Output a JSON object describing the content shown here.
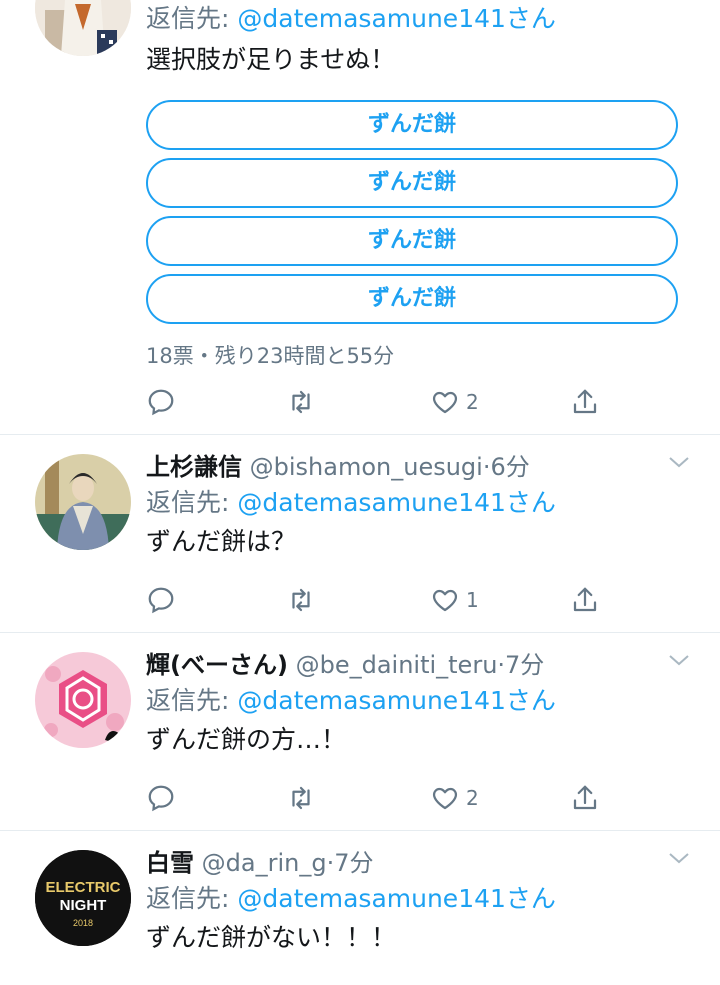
{
  "tweets": [
    {
      "reply_prefix": "返信先: ",
      "reply_mention": "@datemasamune141さん",
      "text": "選択肢が足りませぬ！",
      "poll": {
        "options": [
          "ずんだ餅",
          "ずんだ餅",
          "ずんだ餅",
          "ずんだ餅"
        ],
        "meta": "18票・残り23時間と55分"
      },
      "like_count": "2"
    },
    {
      "name": "上杉謙信",
      "handle": "@bishamon_uesugi",
      "time": "·6分",
      "reply_prefix": "返信先: ",
      "reply_mention": "@datemasamune141さん",
      "text": "ずんだ餅は？",
      "like_count": "1"
    },
    {
      "name": "輝(べーさん)",
      "handle": "@be_dainiti_teru",
      "time": "·7分",
      "reply_prefix": "返信先: ",
      "reply_mention": "@datemasamune141さん",
      "text": "ずんだ餅の方…！",
      "like_count": "2"
    },
    {
      "name": "白雪",
      "handle": "@da_rin_g",
      "time": "·7分",
      "reply_prefix": "返信先: ",
      "reply_mention": "@datemasamune141さん",
      "text": "ずんだ餅がない！！！"
    }
  ],
  "avatar_logo": {
    "line1": "ELECTRIC",
    "line2": "NIGHT",
    "year": "2018"
  },
  "colors": {
    "accent": "#1da1f2",
    "secondary_text": "#657786",
    "divider": "#e6ecf0"
  }
}
